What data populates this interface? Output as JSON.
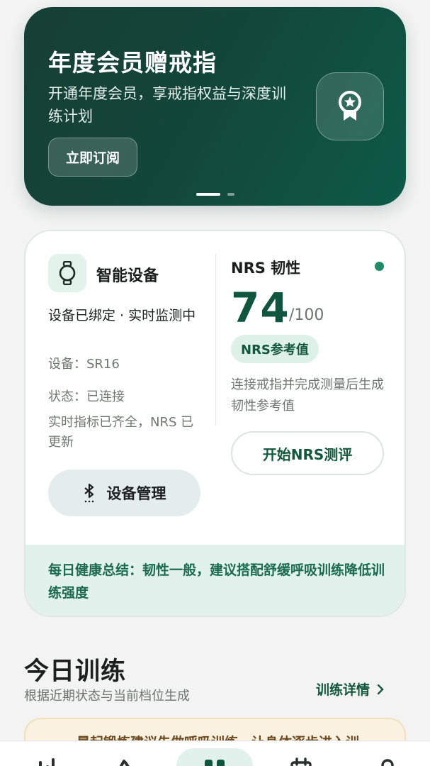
{
  "banner": {
    "title": "年度会员赠戒指",
    "subtitle": "开通年度会员，享戒指权益与深度训练计划",
    "button_label": "立即订阅",
    "badge_icon": "award-icon",
    "page_indicator": {
      "total": 2,
      "active": 1
    }
  },
  "device": {
    "icon": "watch-icon",
    "title": "智能设备",
    "status": "设备已绑定 · 实时监测中",
    "model": "设备：SR16",
    "connection": "状态：已连接",
    "note": "实时指标已齐全，NRS 已更新",
    "manage_label": "设备管理",
    "manage_icon": "bluetooth-icon"
  },
  "nrs": {
    "title": "NRS 韧性",
    "score": "74",
    "max": "/100",
    "badge": "NRS参考值",
    "description": "连接戒指并完成测量后生成韧性参考值",
    "button_label": "开始NRS测评",
    "status_color": "#1e8c66"
  },
  "summary": "每日健康总结：韧性一般，建议搭配舒缓呼吸训练降低训练强度",
  "today": {
    "title": "今日训练",
    "subtitle": "根据近期状态与当前档位生成",
    "link_label": "训练详情",
    "tip": "晨起锻炼建议先做呼吸训练，让身体逐步进入训"
  },
  "tabbar": {
    "items": [
      "stats-icon",
      "training-icon",
      "home-icon",
      "calendar-icon",
      "profile-icon"
    ],
    "active_index": 2
  },
  "colors": {
    "brand": "#10563f",
    "banner_bg": "#173f34",
    "accent_light": "#e0f2eb"
  }
}
